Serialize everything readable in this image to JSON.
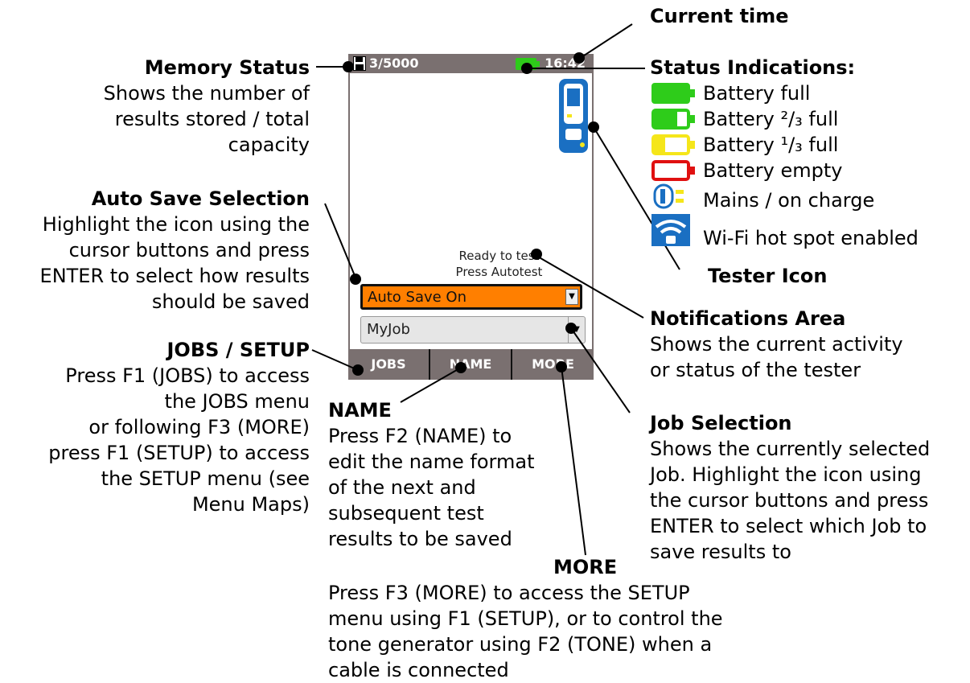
{
  "device": {
    "memory_status": "3/5000",
    "time": "16:42",
    "notification_line1": "Ready to test",
    "notification_line2": "Press Autotest",
    "auto_save_value": "Auto Save On",
    "job_value": "MyJob",
    "softkeys": [
      "JOBS",
      "NAME",
      "MORE"
    ]
  },
  "annotations": {
    "current_time": "Current time",
    "memory_status": {
      "title": "Memory Status",
      "lines": [
        "Shows the number of",
        "results stored / total",
        "capacity"
      ]
    },
    "status_indications": {
      "title": "Status Indications:",
      "items": [
        {
          "label": "Battery full",
          "icon": "battery-full-icon",
          "color": "#2ecc1a"
        },
        {
          "label": "Battery ²/₃ full",
          "icon": "battery-two-thirds-icon",
          "color": "#2ecc1a"
        },
        {
          "label": "Battery ¹/₃ full",
          "icon": "battery-one-third-icon",
          "color": "#f5e61a"
        },
        {
          "label": "Battery empty",
          "icon": "battery-empty-icon",
          "color": "#e01010"
        },
        {
          "label": "Mains / on charge",
          "icon": "mains-charge-icon",
          "color": "#1a6fc2"
        },
        {
          "label": "Wi-Fi hot spot enabled",
          "icon": "wifi-hotspot-icon",
          "color": "#1a6fc2"
        }
      ]
    },
    "tester_icon": "Tester Icon",
    "auto_save": {
      "title": "Auto Save Selection",
      "lines": [
        "Highlight the icon using the",
        "cursor buttons and press",
        "ENTER to select how results",
        "should be saved"
      ]
    },
    "notifications": {
      "title": "Notifications Area",
      "lines": [
        "Shows the current activity",
        "or status of the tester"
      ]
    },
    "jobs_setup": {
      "title": "JOBS / SETUP",
      "lines": [
        "Press F1 (JOBS) to access",
        "the JOBS menu",
        "or following F3 (MORE)",
        "press F1 (SETUP) to access",
        "the SETUP menu (see",
        "Menu Maps)"
      ]
    },
    "name": {
      "title": "NAME",
      "lines": [
        "Press F2 (NAME) to",
        "edit the name format",
        "of the next and",
        "subsequent test",
        "results to be saved"
      ]
    },
    "job_selection": {
      "title": "Job Selection",
      "lines": [
        "Shows the currently selected",
        "Job. Highlight the icon using",
        "the cursor buttons and press",
        "ENTER to select which Job to",
        "save results to"
      ]
    },
    "more": {
      "title": "MORE",
      "lines": [
        "Press F3 (MORE) to access the SETUP",
        "menu using F1 (SETUP), or to control the",
        "tone generator using F2 (TONE) when a",
        "cable is connected"
      ]
    }
  },
  "colors": {
    "status_bar": "#7a7070",
    "auto_save_highlight": "#ff7f00",
    "tester_blue": "#1a6fc2",
    "battery_green": "#2ecc1a"
  }
}
